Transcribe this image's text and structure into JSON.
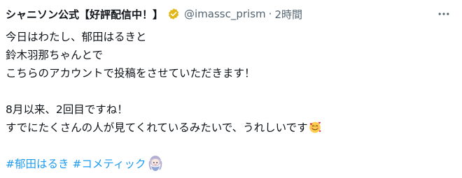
{
  "header": {
    "display_name": "シャニソン公式【好評配信中！】",
    "handle": "@imassc_prism",
    "separator": "·",
    "time": "2時間"
  },
  "tweet": {
    "lines": [
      "今日はわたし、郁田はるきと",
      "鈴木羽那ちゃんとで",
      "こちらのアカウントで投稿をさせていただきます！",
      "",
      "8月以来、2回目ですね！",
      "すでにたくさんの人が見てくれているみたいで、うれしいです"
    ],
    "hashtags": [
      "#郁田はるき",
      "#コメティック"
    ]
  },
  "icons": {
    "verified": "gold-verified-badge-icon",
    "more": "more-options-icon",
    "emoji": "smiling-face-with-hearts-emoji",
    "hashtag_emoji": "comet-chibi-emoji"
  },
  "colors": {
    "text": "#0f1419",
    "secondary": "#536471",
    "link": "#1d9bf0",
    "verified_gold": "#e2b719"
  }
}
